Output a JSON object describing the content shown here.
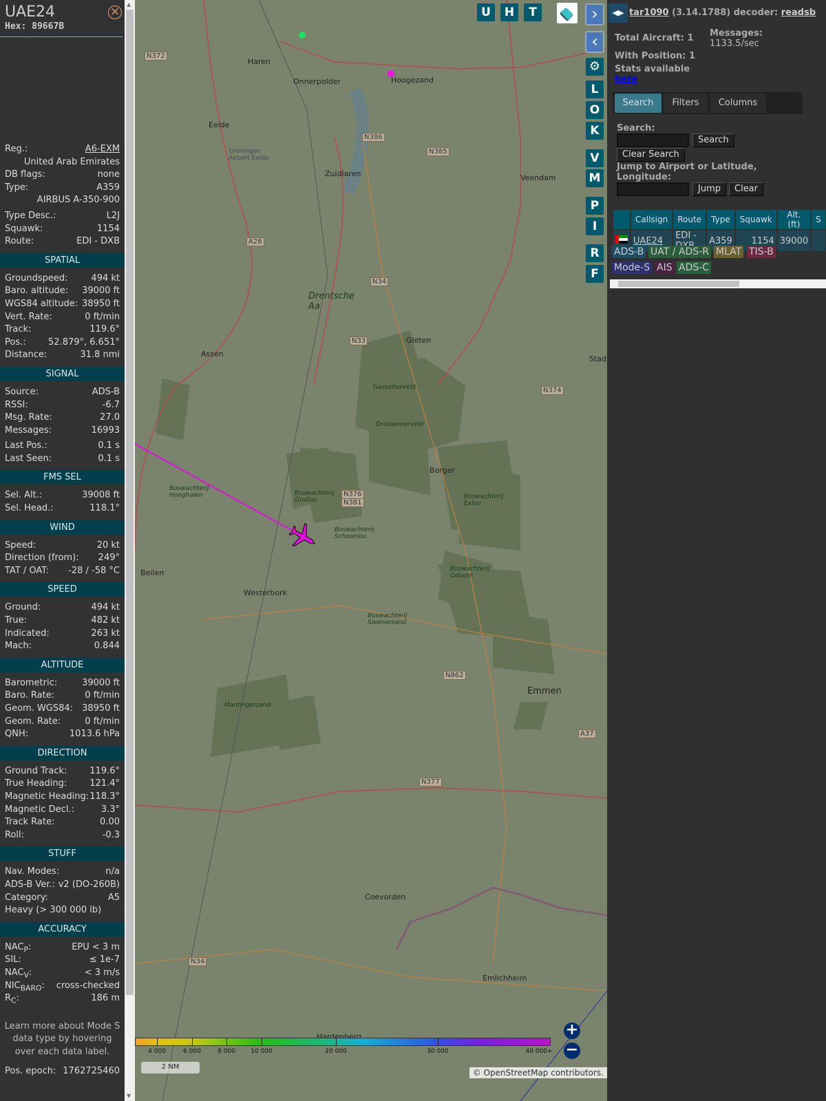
{
  "detail": {
    "callsign": "UAE24",
    "hex": "Hex: 89667B",
    "close_icon": "circle-x",
    "groups": [
      {
        "rows": [
          {
            "label": "Reg.:",
            "value": "A6-EXM",
            "link": true
          },
          {
            "label": "",
            "value": "United Arab Emirates"
          },
          {
            "label": "DB flags:",
            "value": "none"
          },
          {
            "label": "Type:",
            "value": "A359"
          },
          {
            "label": "",
            "value": "AIRBUS A-350-900"
          }
        ]
      },
      {
        "rows": [
          {
            "label": "Type Desc.:",
            "value": "L2J"
          },
          {
            "label": "Squawk:",
            "value": "1154"
          },
          {
            "label": "Route:",
            "value": "EDI - DXB"
          }
        ]
      }
    ],
    "sections": [
      {
        "title": "SPATIAL",
        "groups": [
          [
            {
              "label": "Groundspeed:",
              "value": "494 kt"
            },
            {
              "label": "Baro. altitude:",
              "value": "39000 ft"
            },
            {
              "label": "WGS84 altitude:",
              "value": "38950 ft"
            },
            {
              "label": "Vert. Rate:",
              "value": "0 ft/min"
            },
            {
              "label": "Track:",
              "value": "119.6°"
            },
            {
              "label": "Pos.:",
              "value": "52.879°, 6.651°"
            },
            {
              "label": "Distance:",
              "value": "31.8 nmi"
            }
          ]
        ]
      },
      {
        "title": "SIGNAL",
        "groups": [
          [
            {
              "label": "Source:",
              "value": "ADS-B"
            },
            {
              "label": "RSSI:",
              "value": "-6.7"
            },
            {
              "label": "Msg. Rate:",
              "value": "27.0"
            },
            {
              "label": "Messages:",
              "value": "16993"
            }
          ],
          [
            {
              "label": "Last Pos.:",
              "value": "0.1 s"
            },
            {
              "label": "Last Seen:",
              "value": "0.1 s"
            }
          ]
        ]
      },
      {
        "title": "FMS SEL",
        "groups": [
          [
            {
              "label": "Sel. Alt.:",
              "value": "39008 ft"
            },
            {
              "label": "Sel. Head.:",
              "value": "118.1°"
            }
          ]
        ]
      },
      {
        "title": "WIND",
        "groups": [
          [
            {
              "label": "Speed:",
              "value": "20 kt"
            },
            {
              "label": "Direction (from):",
              "value": "249°"
            },
            {
              "label": "TAT / OAT:",
              "value": "-28 / -58 °C"
            }
          ]
        ]
      },
      {
        "title": "SPEED",
        "groups": [
          [
            {
              "label": "Ground:",
              "value": "494 kt"
            },
            {
              "label": "True:",
              "value": "482 kt"
            },
            {
              "label": "Indicated:",
              "value": "263 kt"
            },
            {
              "label": "Mach:",
              "value": "0.844"
            }
          ]
        ]
      },
      {
        "title": "ALTITUDE",
        "groups": [
          [
            {
              "label": "Barometric:",
              "value": "39000 ft"
            },
            {
              "label": "Baro. Rate:",
              "value": "0 ft/min"
            },
            {
              "label": "Geom. WGS84:",
              "value": "38950 ft"
            },
            {
              "label": "Geom. Rate:",
              "value": "0 ft/min"
            },
            {
              "label": "QNH:",
              "value": "1013.6 hPa"
            }
          ]
        ]
      },
      {
        "title": "DIRECTION",
        "groups": [
          [
            {
              "label": "Ground Track:",
              "value": "119.6°"
            },
            {
              "label": "True Heading:",
              "value": "121.4°"
            },
            {
              "label": "Magnetic Heading:",
              "value": "118.3°"
            },
            {
              "label": "Magnetic Decl.:",
              "value": "3.3°"
            },
            {
              "label": "Track Rate:",
              "value": "0.00"
            },
            {
              "label": "Roll:",
              "value": "-0.3"
            }
          ]
        ]
      },
      {
        "title": "STUFF",
        "groups": [
          [
            {
              "label": "Nav. Modes:",
              "value": "n/a"
            },
            {
              "label": "ADS-B Ver.:",
              "value": "v2 (DO-260B)"
            },
            {
              "label": "Category:",
              "value": "A5"
            },
            {
              "label": "Heavy (> 300 000 lb)",
              "value": ""
            }
          ]
        ]
      },
      {
        "title": "ACCURACY",
        "groups": [
          [
            {
              "label": "NAC<sub>P</sub>:",
              "value": "EPU < 3 m",
              "html": true
            },
            {
              "label": "SIL:",
              "value": "≤ 1e-7"
            },
            {
              "label": "NAC<sub>V</sub>:",
              "value": "< 3 m/s",
              "html": true
            },
            {
              "label": "NIC<sub>BARO</sub>:",
              "value": "cross-checked",
              "html": true
            },
            {
              "label": "R<sub>C</sub>:",
              "value": "186 m",
              "html": true
            }
          ]
        ]
      }
    ],
    "note": "Learn more about Mode S data type by hovering over each data label.",
    "pos_epoch_label": "Pos. epoch:",
    "pos_epoch": "1762725460"
  },
  "map": {
    "top_buttons": [
      "U",
      "H",
      "T"
    ],
    "side_buttons": [
      "L",
      "O",
      "K",
      "V",
      "M",
      "P",
      "I",
      "R",
      "F"
    ],
    "places": [
      "Haren",
      "Hoogezand",
      "Onnerpolder",
      "Eelde",
      "Groningen Airport Eelde",
      "Zuidlaren",
      "Veendam",
      "Drentsche Aa",
      "Assen",
      "Gieten",
      "Gasselterveld",
      "Drouwenerveld",
      "Borger",
      "Boswachterij Hooghalen",
      "Boswachterij Grolloo",
      "Boswachterij Schoonloo",
      "Boswachterij Exloo",
      "Boswachterij Odoorn",
      "Beilen",
      "Westerbork",
      "Boswachterij Sleenerzand",
      "Emmen",
      "Mantingerzand",
      "Coevorden",
      "Emlichheim",
      "Hardenberg",
      "Stads"
    ],
    "roads": [
      "N372",
      "N386",
      "N385",
      "A28",
      "N34",
      "N33",
      "N374",
      "N376",
      "N381",
      "N862",
      "A37",
      "N377",
      "N34"
    ],
    "altitude_legend": [
      "4 000",
      "6 000",
      "8 000",
      "10 000",
      "20 000",
      "30 000",
      "40 000+"
    ],
    "scale": "2 NM",
    "attribution": "© OpenStreetMap contributors.",
    "aircraft_color": "#e010e0"
  },
  "panel": {
    "app": "tar1090",
    "version": "(3.14.1788) decoder:",
    "decoder": "readsb",
    "total_aircraft": "Total Aircraft: 1",
    "messages_label": "Messages:",
    "messages": "1133.5/sec",
    "with_position": "With Position: 1",
    "stats": "Stats available",
    "stats_link": "here",
    "tabs": [
      "Search",
      "Filters",
      "Columns"
    ],
    "search_label": "Search:",
    "search_button": "Search",
    "clear_search": "Clear Search",
    "jump_label": "Jump to Airport or Latitude, Longitude:",
    "jump_button": "Jump",
    "clear_button": "Clear",
    "columns": [
      "",
      "Callsign",
      "Route",
      "Type",
      "Squawk",
      "Alt. (ft)",
      "S"
    ],
    "rows": [
      {
        "callsign": "UAE24",
        "route": "EDI - DXB",
        "type": "A359",
        "squawk": "1154",
        "alt": "39000"
      }
    ],
    "legend": [
      {
        "label": "ADS-B",
        "color": "#1f4d64"
      },
      {
        "label": "UAT / ADS-R",
        "color": "#2a5e3a"
      },
      {
        "label": "MLAT",
        "color": "#6b5f2f"
      },
      {
        "label": "TIS-B",
        "color": "#6b2840"
      },
      {
        "label": "Mode-S",
        "color": "#2d2f70"
      },
      {
        "label": "AIS",
        "color": "#4a2242"
      },
      {
        "label": "ADS-C",
        "color": "#27603e"
      }
    ]
  }
}
